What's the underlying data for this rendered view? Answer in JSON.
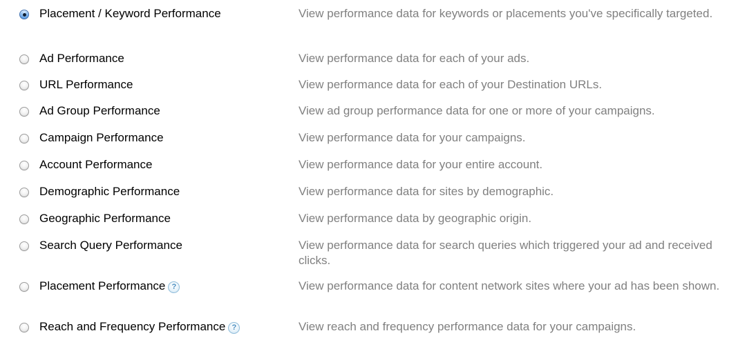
{
  "reports": [
    {
      "name": "Placement / Keyword Performance",
      "description": "View performance data for keywords or placements you've specifically targeted.",
      "selected": true,
      "help": false
    },
    {
      "name": "Ad Performance",
      "description": "View performance data for each of your ads.",
      "selected": false,
      "help": false
    },
    {
      "name": "URL Performance",
      "description": "View performance data for each of your Destination URLs.",
      "selected": false,
      "help": false
    },
    {
      "name": "Ad Group Performance",
      "description": "View ad group performance data for one or more of your campaigns.",
      "selected": false,
      "help": false
    },
    {
      "name": "Campaign Performance",
      "description": "View performance data for your campaigns.",
      "selected": false,
      "help": false
    },
    {
      "name": "Account Performance",
      "description": "View performance data for your entire account.",
      "selected": false,
      "help": false
    },
    {
      "name": "Demographic Performance",
      "description": "View performance data for sites by demographic.",
      "selected": false,
      "help": false
    },
    {
      "name": "Geographic Performance",
      "description": "View performance data by geographic origin.",
      "selected": false,
      "help": false
    },
    {
      "name": "Search Query Performance",
      "description": "View performance data for search queries which triggered your ad and received clicks.",
      "selected": false,
      "help": false
    },
    {
      "name": "Placement Performance",
      "description": "View performance data for content network sites where your ad has been shown.",
      "selected": false,
      "help": true
    },
    {
      "name": "Reach and Frequency Performance",
      "description": "View reach and frequency performance data for your campaigns.",
      "selected": false,
      "help": true
    }
  ],
  "help_glyph": "?",
  "icons": {
    "radio_selected": "radio-selected-icon",
    "radio_unselected": "radio-unselected-icon",
    "help": "help-icon"
  },
  "colors": {
    "label": "#000000",
    "description": "#808080",
    "radio_selected": "#3f86d6",
    "help_icon": "#4a8ec0"
  }
}
